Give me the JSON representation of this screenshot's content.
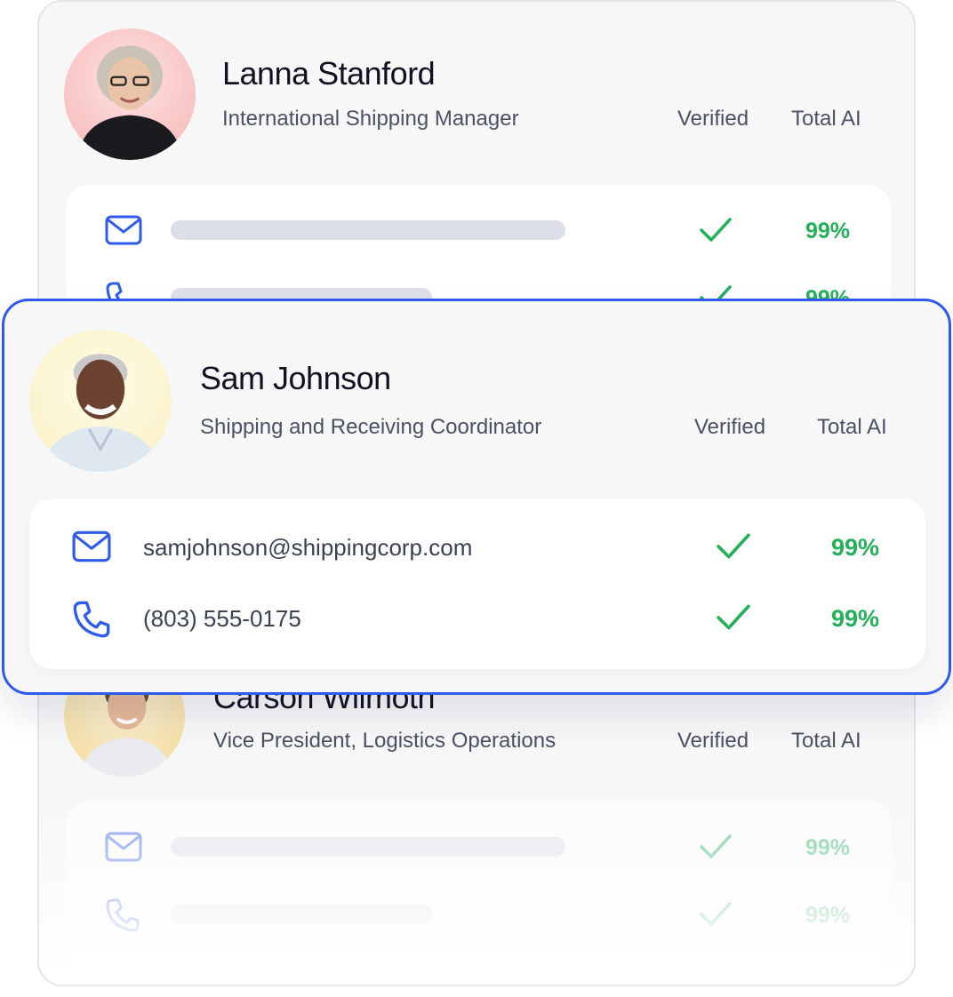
{
  "profiles": [
    {
      "name": "Lanna Stanford",
      "role": "International Shipping Manager",
      "verified_label": "Verified",
      "total_label": "Total AI",
      "email_score": "99%",
      "phone_score": "99%"
    },
    {
      "name": "Sam Johnson",
      "role": "Shipping and Receiving Coordinator",
      "verified_label": "Verified",
      "total_label": "Total AI",
      "email": "samjohnson@shippingcorp.com",
      "phone": "(803) 555-0175",
      "email_score": "99%",
      "phone_score": "99%"
    },
    {
      "name": "Carson Wilmoth",
      "role": "Vice President, Logistics Operations",
      "verified_label": "Verified",
      "total_label": "Total AI",
      "email_score": "99%",
      "phone_score": "99%"
    }
  ],
  "colors": {
    "accent_blue": "#2f5bea",
    "check_green": "#22b05a",
    "placeholder_gray": "#dcdfe8"
  },
  "icons": [
    "mail-icon",
    "phone-icon",
    "checkmark-icon"
  ]
}
